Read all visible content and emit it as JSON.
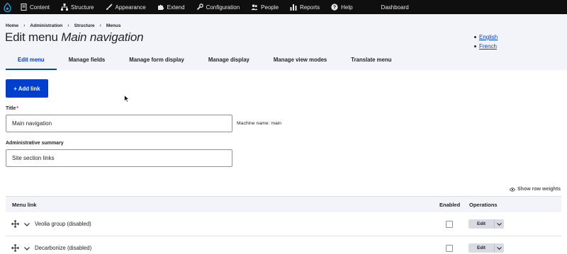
{
  "toolbar": {
    "items": [
      {
        "label": "Content",
        "icon": "document-icon"
      },
      {
        "label": "Structure",
        "icon": "sitemap-icon"
      },
      {
        "label": "Appearance",
        "icon": "brush-icon"
      },
      {
        "label": "Extend",
        "icon": "puzzle-icon"
      },
      {
        "label": "Configuration",
        "icon": "wrench-icon"
      },
      {
        "label": "People",
        "icon": "people-icon"
      },
      {
        "label": "Reports",
        "icon": "bar-chart-icon"
      },
      {
        "label": "Help",
        "icon": "help-icon"
      }
    ],
    "dashboard": "Dashboard"
  },
  "breadcrumb": [
    "Home",
    "Administration",
    "Structure",
    "Menus"
  ],
  "page_title": {
    "prefix": "Edit menu ",
    "name": "Main navigation"
  },
  "languages": [
    "English",
    "French"
  ],
  "tabs": [
    "Edit menu",
    "Manage fields",
    "Manage form display",
    "Manage display",
    "Manage view modes",
    "Translate menu"
  ],
  "add_link_label": "+ Add link",
  "title_field": {
    "label": "Title",
    "required_mark": "*",
    "value": "Main navigation"
  },
  "machine_name": "Machine name: main",
  "summary_field": {
    "label": "Administrative summary",
    "value": "Site section links"
  },
  "show_row_weights": "Show row weights",
  "table": {
    "headers": {
      "link": "Menu link",
      "enabled": "Enabled",
      "operations": "Operations"
    },
    "rows": [
      {
        "label": "Veolia group (disabled)",
        "enabled": false,
        "edit": "Edit"
      },
      {
        "label": "Decarbonize (disabled)",
        "enabled": false,
        "edit": "Edit"
      }
    ]
  },
  "colors": {
    "accent": "#003ecc",
    "toolbar": "#0f0f0f",
    "header_bg": "#f3f4f9"
  }
}
